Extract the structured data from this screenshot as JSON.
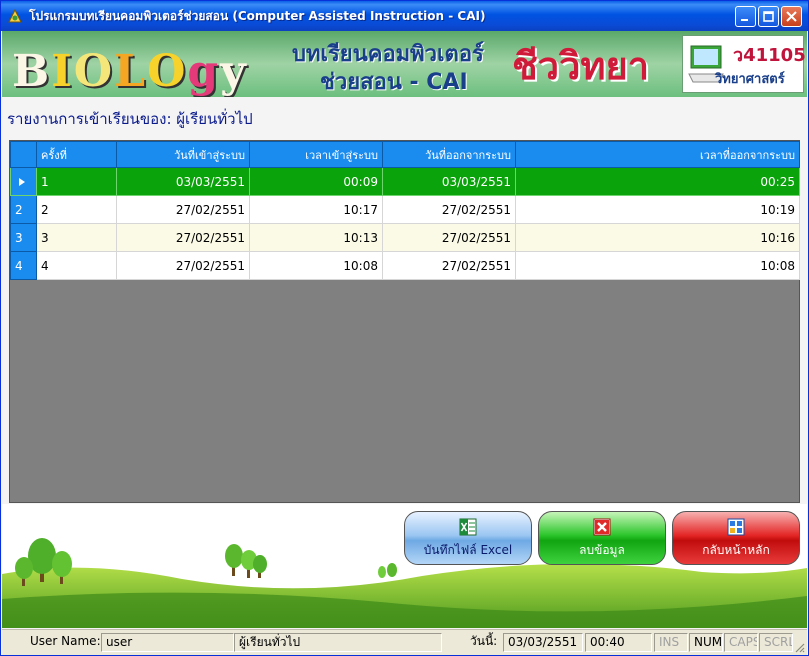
{
  "window": {
    "title": "โปรแกรมบทเรียนคอมพิวเตอร์ช่วยสอน (Computer Assisted Instruction - CAI)"
  },
  "banner": {
    "letters": [
      "B",
      "I",
      "O",
      "L",
      "O",
      "g",
      "y"
    ],
    "thai_line1": "บทเรียนคอมพิวเตอร์",
    "thai_line2": "ช่วยสอน  -  CAI",
    "big": "ชีววิทยา",
    "code": "ว41105",
    "subject": "วิทยาศาสตร์"
  },
  "heading": "รายงานการเข้าเรียนของ: ผู้เรียนทั่วไป",
  "table": {
    "headers": [
      "ครั้งที่",
      "วันที่เข้าสู่ระบบ",
      "เวลาเข้าสู่ระบบ",
      "วันที่ออกจากระบบ",
      "เวลาที่ออกจากระบบ"
    ],
    "rows": [
      {
        "row_header": "",
        "no": "1",
        "date_in": "03/03/2551",
        "time_in": "00:09",
        "date_out": "03/03/2551",
        "time_out": "00:25"
      },
      {
        "row_header": "2",
        "no": "2",
        "date_in": "27/02/2551",
        "time_in": "10:17",
        "date_out": "27/02/2551",
        "time_out": "10:19"
      },
      {
        "row_header": "3",
        "no": "3",
        "date_in": "27/02/2551",
        "time_in": "10:13",
        "date_out": "27/02/2551",
        "time_out": "10:16"
      },
      {
        "row_header": "4",
        "no": "4",
        "date_in": "27/02/2551",
        "time_in": "10:08",
        "date_out": "27/02/2551",
        "time_out": "10:08"
      }
    ]
  },
  "buttons": {
    "excel": "บันทึกไฟล์ Excel",
    "delete": "ลบข้อมูล",
    "back": "กลับหน้าหลัก"
  },
  "statusbar": {
    "user_label": "User Name:",
    "user_value": "user",
    "role": "ผู้เรียนทั่วไป",
    "date_label": "วันนี้:",
    "date_value": "03/03/2551",
    "time_value": "00:40",
    "ins": "INS",
    "num": "NUM",
    "caps": "CAPS",
    "scrl": "SCRL"
  }
}
